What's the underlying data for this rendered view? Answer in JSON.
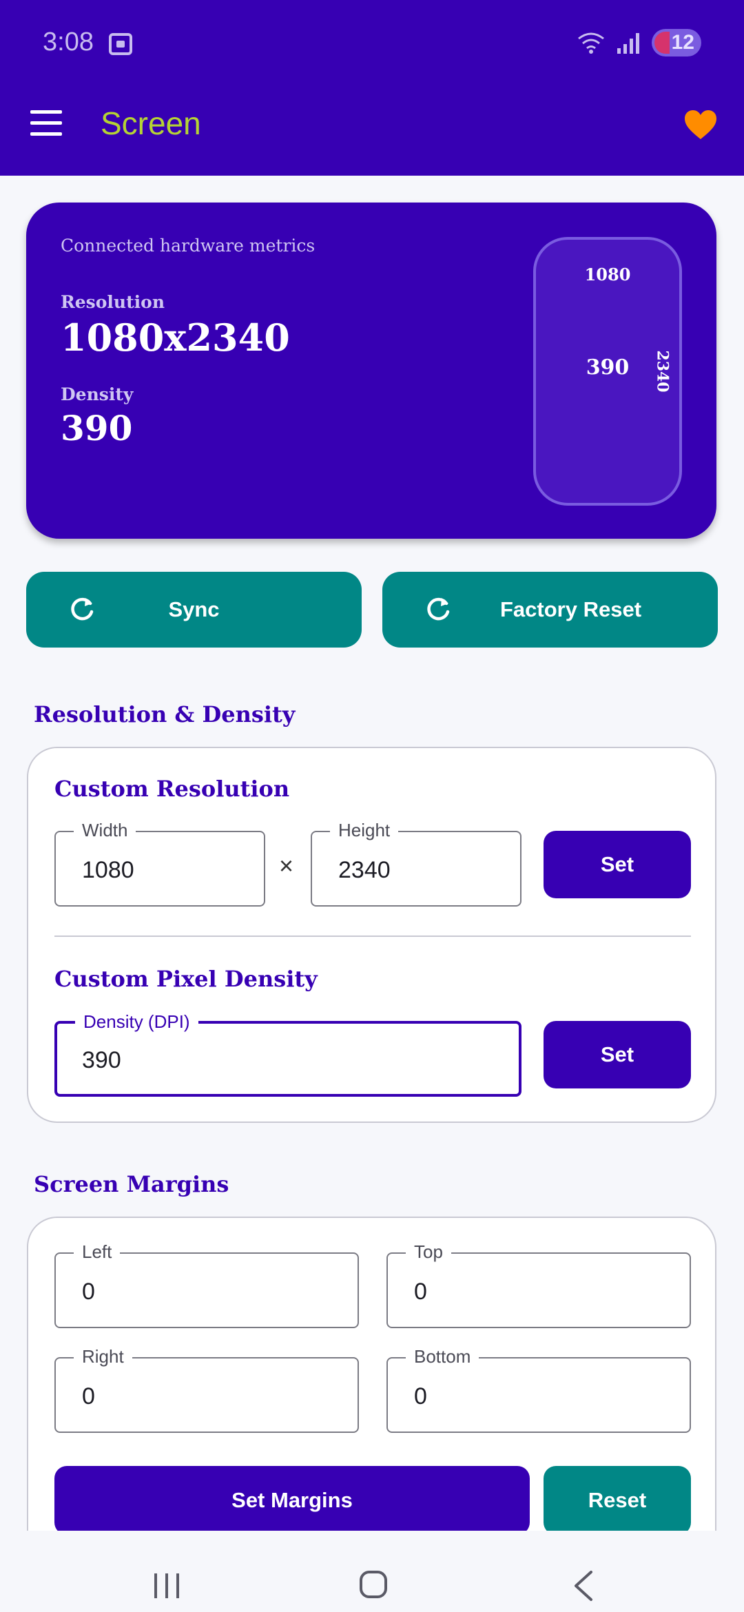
{
  "status_bar": {
    "time": "3:08",
    "battery": "12"
  },
  "app_bar": {
    "title": "Screen"
  },
  "hardware": {
    "caption": "Connected hardware metrics",
    "resolution_label": "Resolution",
    "resolution_value": "1080x2340",
    "density_label": "Density",
    "density_value": "390",
    "phone_width": "1080",
    "phone_height": "2340",
    "phone_density": "390"
  },
  "actions": {
    "sync_label": "Sync",
    "factory_reset_label": "Factory Reset"
  },
  "resolution_density": {
    "section_title": "Resolution & Density",
    "custom_resolution_title": "Custom Resolution",
    "width_label": "Width",
    "width_value": "1080",
    "times": "×",
    "height_label": "Height",
    "height_value": "2340",
    "set_resolution_label": "Set",
    "custom_density_title": "Custom Pixel Density",
    "density_label": "Density (DPI)",
    "density_value": "390",
    "set_density_label": "Set"
  },
  "margins": {
    "section_title": "Screen Margins",
    "left_label": "Left",
    "left_value": "0",
    "top_label": "Top",
    "top_value": "0",
    "right_label": "Right",
    "right_value": "0",
    "bottom_label": "Bottom",
    "bottom_value": "0",
    "set_margins_label": "Set Margins",
    "reset_label": "Reset"
  },
  "colors": {
    "primary": "#3700b3",
    "teal": "#018786",
    "title_accent": "#b5d334",
    "heart": "#ff8c00"
  }
}
